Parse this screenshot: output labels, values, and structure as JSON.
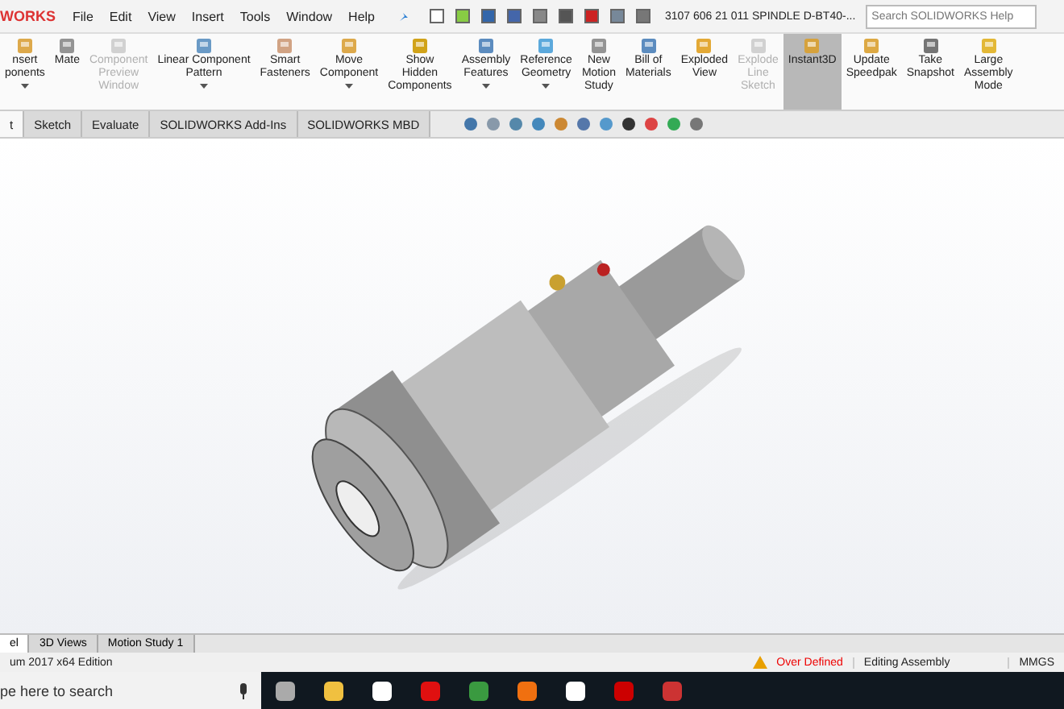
{
  "title_bar": {
    "logo": "WORKS",
    "menu": [
      "File",
      "Edit",
      "View",
      "Insert",
      "Tools",
      "Window",
      "Help"
    ],
    "document_title": "3107 606 21 011 SPINDLE D-BT40-...",
    "search": {
      "placeholder": "Search SOLIDWORKS Help"
    }
  },
  "ribbon": [
    {
      "label": "nsert\nponents",
      "dropdown": true,
      "disabled": false,
      "selected": false
    },
    {
      "label": "Mate",
      "dropdown": false,
      "disabled": false,
      "selected": false
    },
    {
      "label": "Component\nPreview\nWindow",
      "dropdown": false,
      "disabled": true,
      "selected": false
    },
    {
      "label": "Linear Component\nPattern",
      "dropdown": true,
      "disabled": false,
      "selected": false
    },
    {
      "label": "Smart\nFasteners",
      "dropdown": false,
      "disabled": false,
      "selected": false
    },
    {
      "label": "Move\nComponent",
      "dropdown": true,
      "disabled": false,
      "selected": false
    },
    {
      "label": "Show\nHidden\nComponents",
      "dropdown": false,
      "disabled": false,
      "selected": false
    },
    {
      "label": "Assembly\nFeatures",
      "dropdown": true,
      "disabled": false,
      "selected": false
    },
    {
      "label": "Reference\nGeometry",
      "dropdown": true,
      "disabled": false,
      "selected": false
    },
    {
      "label": "New\nMotion\nStudy",
      "dropdown": false,
      "disabled": false,
      "selected": false
    },
    {
      "label": "Bill of\nMaterials",
      "dropdown": false,
      "disabled": false,
      "selected": false
    },
    {
      "label": "Exploded\nView",
      "dropdown": false,
      "disabled": false,
      "selected": false
    },
    {
      "label": "Explode\nLine\nSketch",
      "dropdown": false,
      "disabled": true,
      "selected": false
    },
    {
      "label": "Instant3D",
      "dropdown": false,
      "disabled": false,
      "selected": true
    },
    {
      "label": "Update\nSpeedpak",
      "dropdown": false,
      "disabled": false,
      "selected": false
    },
    {
      "label": "Take\nSnapshot",
      "dropdown": false,
      "disabled": false,
      "selected": false
    },
    {
      "label": "Large\nAssembly\nMode",
      "dropdown": false,
      "disabled": false,
      "selected": false
    }
  ],
  "command_tabs": [
    {
      "label": "t",
      "selected": true
    },
    {
      "label": "Sketch",
      "selected": false
    },
    {
      "label": "Evaluate",
      "selected": false
    },
    {
      "label": "SOLIDWORKS Add-Ins",
      "selected": false
    },
    {
      "label": "SOLIDWORKS MBD",
      "selected": false
    }
  ],
  "bottom_tabs": [
    {
      "label": "el",
      "selected": true
    },
    {
      "label": "3D Views",
      "selected": false
    },
    {
      "label": "Motion Study 1",
      "selected": false
    }
  ],
  "status_bar": {
    "edition": "um 2017 x64 Edition",
    "warning": "Over Defined",
    "mode": "Editing Assembly",
    "units": "MMGS"
  },
  "taskbar": {
    "search": "pe here to search"
  }
}
